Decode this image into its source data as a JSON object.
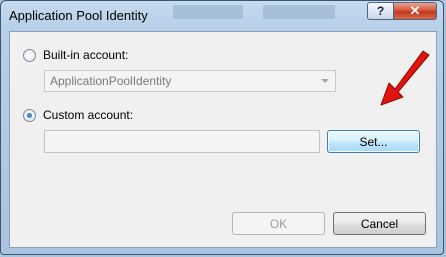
{
  "window": {
    "title": "Application Pool Identity"
  },
  "titlebar": {
    "help_label": "?",
    "close_label": "✕"
  },
  "builtin": {
    "label": "Built-in account:",
    "checked": false,
    "combo_value": "ApplicationPoolIdentity",
    "enabled": false
  },
  "custom": {
    "label": "Custom account:",
    "checked": true,
    "value": "",
    "set_label": "Set..."
  },
  "buttons": {
    "ok_label": "OK",
    "ok_enabled": false,
    "cancel_label": "Cancel"
  },
  "annotation": {
    "icon": "red-arrow-icon",
    "color": "#e1140f"
  }
}
